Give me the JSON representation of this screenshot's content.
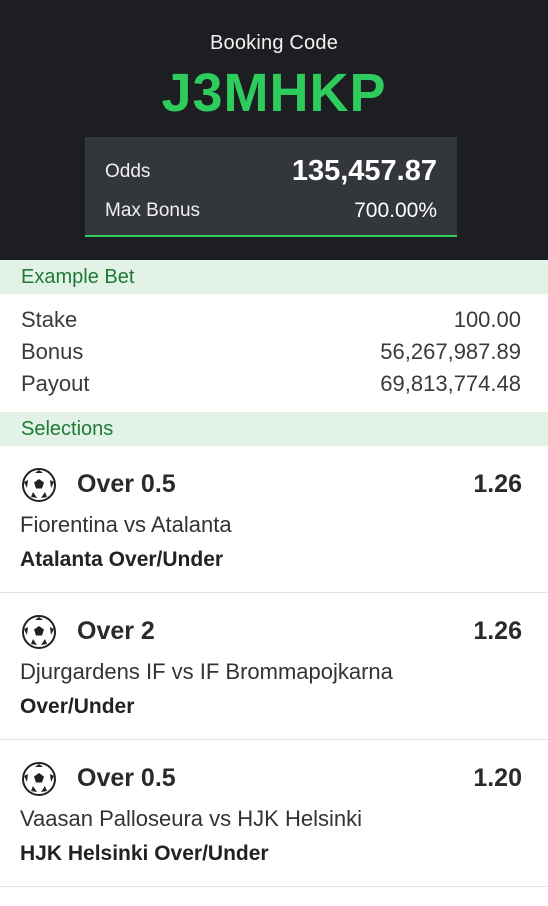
{
  "booking": {
    "label": "Booking Code",
    "code": "J3MHKP",
    "odds_label": "Odds",
    "odds_value": "135,457.87",
    "bonus_label": "Max Bonus",
    "bonus_value": "700.00%"
  },
  "example_bet": {
    "header": "Example Bet",
    "rows": [
      {
        "label": "Stake",
        "value": "100.00"
      },
      {
        "label": "Bonus",
        "value": "56,267,987.89"
      },
      {
        "label": "Payout",
        "value": "69,813,774.48"
      }
    ]
  },
  "selections": {
    "header": "Selections",
    "items": [
      {
        "icon": "soccer-ball-icon",
        "pick": "Over 0.5",
        "odds": "1.26",
        "match": "Fiorentina vs Atalanta",
        "market": "Atalanta Over/Under"
      },
      {
        "icon": "soccer-ball-icon",
        "pick": "Over 2",
        "odds": "1.26",
        "match": "Djurgardens IF vs IF Brommapojkarna",
        "market": "Over/Under"
      },
      {
        "icon": "soccer-ball-icon",
        "pick": "Over 0.5",
        "odds": "1.20",
        "match": "Vaasan Palloseura vs HJK Helsinki",
        "market": "HJK Helsinki Over/Under"
      }
    ]
  },
  "colors": {
    "header_bg": "#1c1e21",
    "accent_green": "#2ecc5c",
    "section_bg": "#e3f2e6",
    "section_text": "#1e7a35"
  }
}
